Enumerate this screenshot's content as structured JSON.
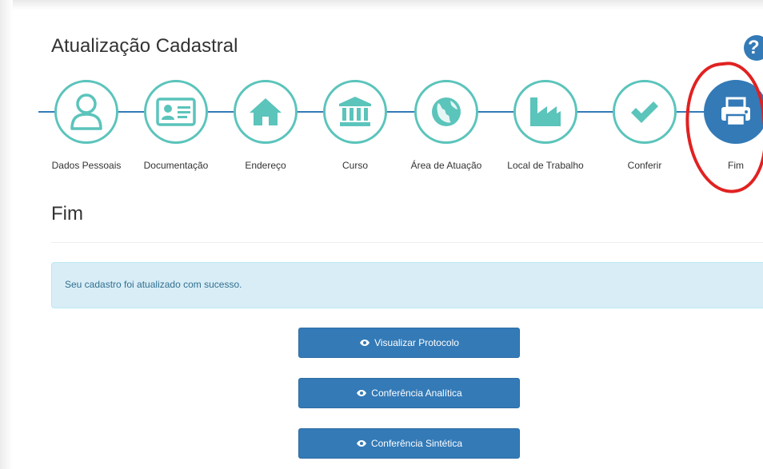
{
  "header": {
    "title": "Atualização Cadastral",
    "help_glyph": "?"
  },
  "wizard": {
    "steps": [
      {
        "label": "Dados Pessoais",
        "icon": "user-icon",
        "state": "done"
      },
      {
        "label": "Documentação",
        "icon": "id-card-icon",
        "state": "done"
      },
      {
        "label": "Endereço",
        "icon": "home-icon",
        "state": "done"
      },
      {
        "label": "Curso",
        "icon": "institution-icon",
        "state": "done"
      },
      {
        "label": "Área de Atuação",
        "icon": "globe-icon",
        "state": "done"
      },
      {
        "label": "Local de Trabalho",
        "icon": "industry-icon",
        "state": "done"
      },
      {
        "label": "Conferir",
        "icon": "check-icon",
        "state": "done"
      },
      {
        "label": "Fim",
        "icon": "print-icon",
        "state": "active"
      }
    ]
  },
  "section": {
    "title": "Fim"
  },
  "alert": {
    "message": "Seu cadastro foi atualizado com sucesso."
  },
  "actions": {
    "view_protocol": "Visualizar Protocolo",
    "analytic_check": "Conferência Analítica",
    "synthetic_check": "Conferência Sintética"
  },
  "colors": {
    "primary": "#337ab7",
    "step_accent": "#5bc4bb",
    "alert_bg": "#d9edf7",
    "alert_text": "#31708f",
    "annotation": "#e12121"
  }
}
